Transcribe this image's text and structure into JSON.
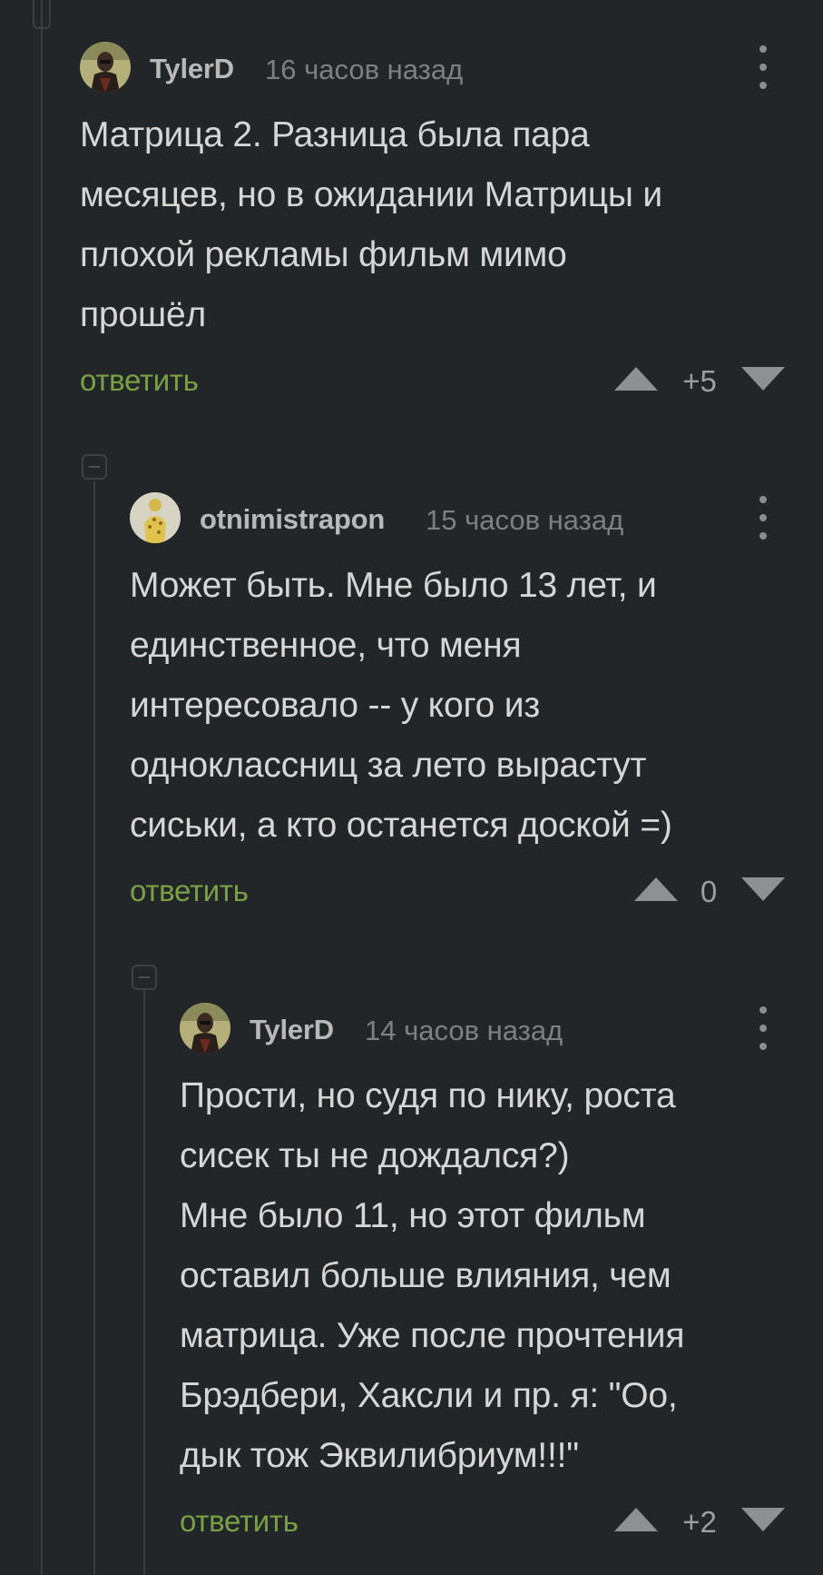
{
  "comments": [
    {
      "username": "TylerD",
      "timestamp": "16 часов назад",
      "text": "Матрица 2. Разница была пара\nмесяцев, но в ожидании Матрицы и\nплохой рекламы фильм мимо\nпрошёл",
      "reply_label": "ответить",
      "score": "+5",
      "avatar_icon": "user-avatar-dark-figure"
    },
    {
      "username": "otnimistrapon",
      "timestamp": "15 часов назад",
      "text": "Может быть. Мне было 13 лет, и\nединственное, что меня\nинтересовало -- у кого из\nодноклассниц за лето вырастут\nсиськи, а кто останется доской =)",
      "reply_label": "ответить",
      "score": "0",
      "avatar_icon": "user-avatar-yellow-figure"
    },
    {
      "username": "TylerD",
      "timestamp": "14 часов назад",
      "text": "Прости, но судя по нику, роста\nсисек ты не дождался?)\nМне было 11, но этот фильм\nоставил больше влияния, чем\nматрица. Уже после прочтения\nБрэдбери, Хаксли и пр. я: \"Оо,\nдык тож Эквилибриум!!!\"",
      "reply_label": "ответить",
      "score": "+2",
      "avatar_icon": "user-avatar-dark-figure"
    }
  ],
  "colors": {
    "background": "#232629",
    "reply_link": "#7aa046",
    "vote_arrow": "#8e9093",
    "thread_line": "#3a3e42"
  }
}
